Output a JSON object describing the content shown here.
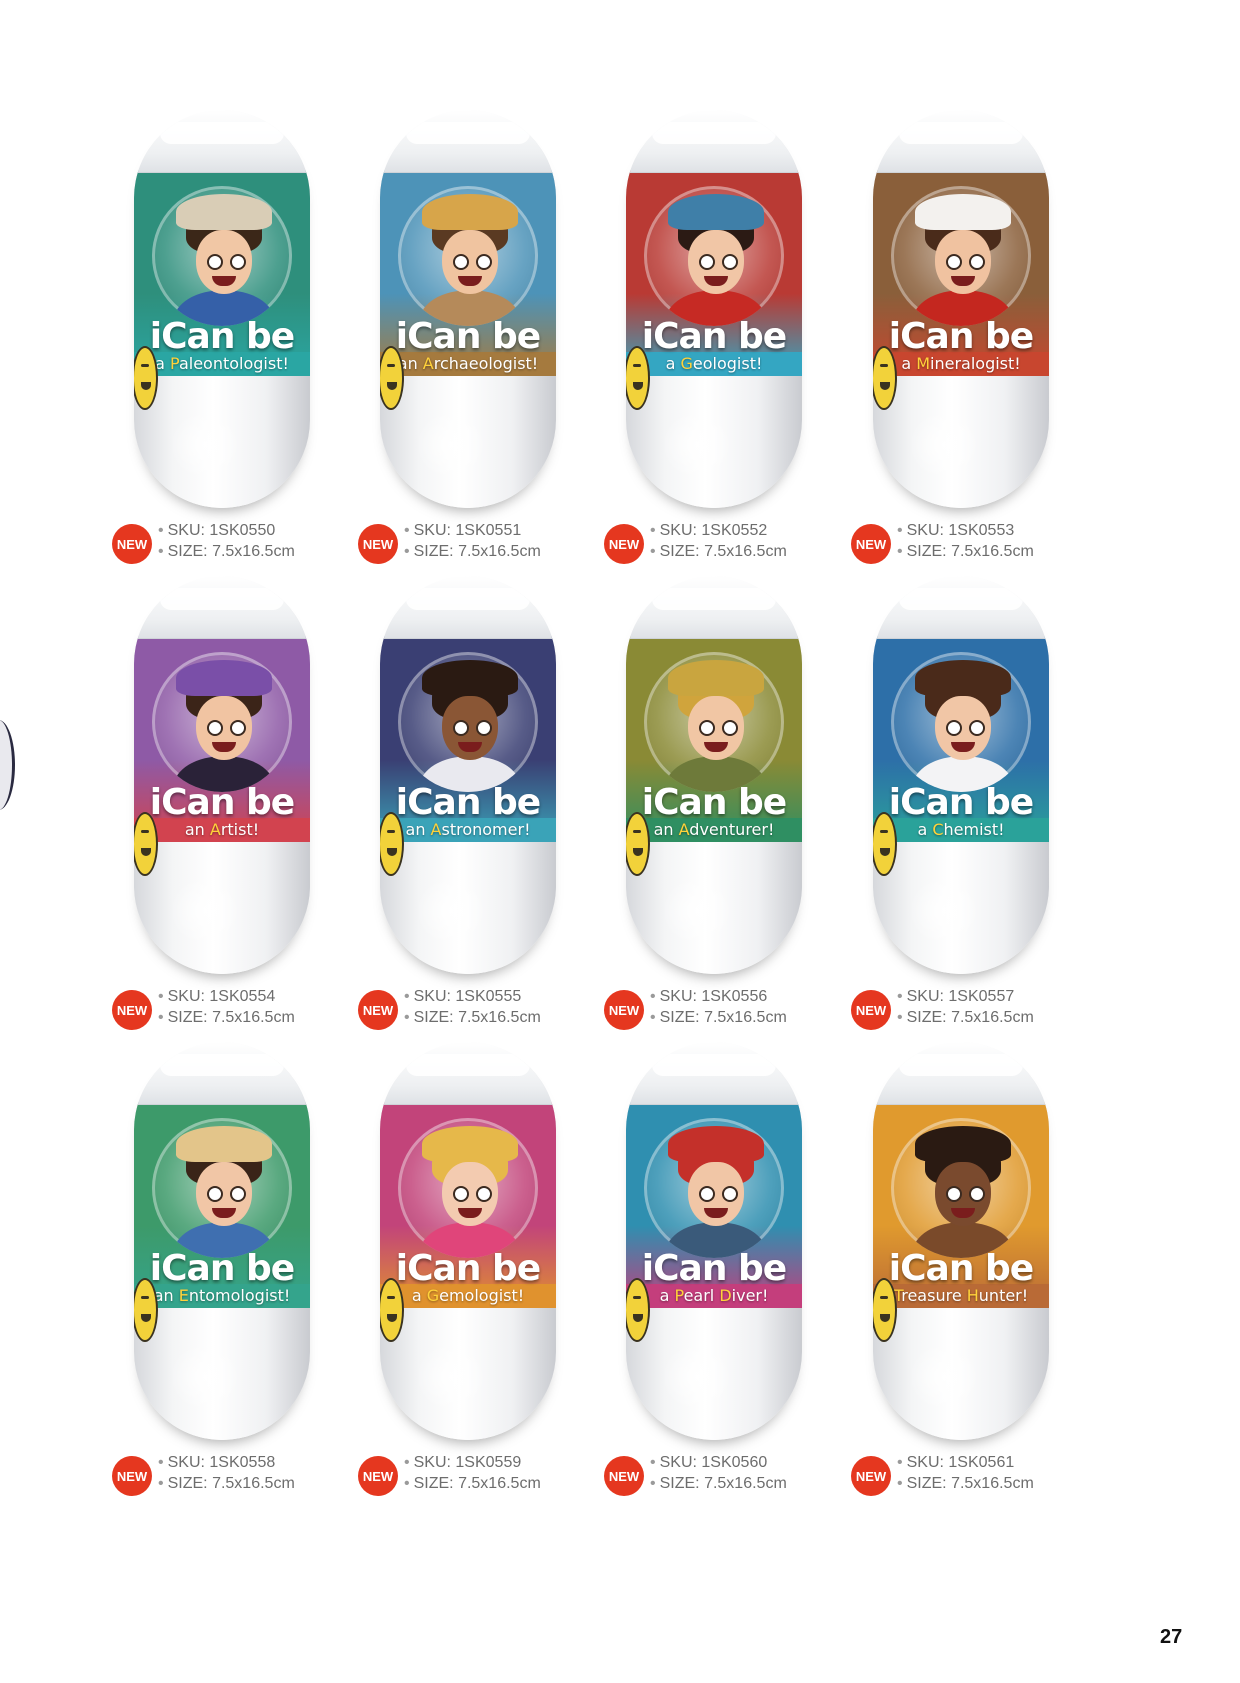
{
  "page_number": "27",
  "brand": "iCan be",
  "badge": "NEW",
  "products": [
    {
      "label_prefix": "a ",
      "label_initial": "P",
      "label_rest": "aleontologist!",
      "sku": "SKU: 1SK0550",
      "size": "SIZE: 7.5x16.5cm",
      "color_top": "#2e8f7c",
      "color_band": "#2aa6a3",
      "hair": "#3b2718",
      "hat": "#d9cdb6",
      "body": "#3560a8",
      "face": "#f1c7a5"
    },
    {
      "label_prefix": "an ",
      "label_initial": "A",
      "label_rest": "rchaeologist!",
      "sku": "SKU: 1SK0551",
      "size": "SIZE: 7.5x16.5cm",
      "color_top": "#4d93b8",
      "color_band": "#a57a3e",
      "hair": "#5a3a22",
      "hat": "#d7a54a",
      "body": "#b58a5a",
      "face": "#f0c4a0"
    },
    {
      "label_prefix": "a ",
      "label_initial": "G",
      "label_rest": "eologist!",
      "sku": "SKU: 1SK0552",
      "size": "SIZE: 7.5x16.5cm",
      "color_top": "#b93a34",
      "color_band": "#34a6c2",
      "hair": "#2b1a14",
      "hat": "#3f7fa8",
      "body": "#c62a24",
      "face": "#f1c6a6"
    },
    {
      "label_prefix": "a ",
      "label_initial": "M",
      "label_rest": "ineralogist!",
      "sku": "SKU: 1SK0553",
      "size": "SIZE: 7.5x16.5cm",
      "color_top": "#8a5f3a",
      "color_band": "#c8462f",
      "hair": "#4a2b1a",
      "hat": "#f3f1ee",
      "body": "#c4271f",
      "face": "#f0c2a0"
    },
    {
      "label_prefix": "an ",
      "label_initial": "A",
      "label_rest": "rtist!",
      "sku": "SKU: 1SK0554",
      "size": "SIZE: 7.5x16.5cm",
      "color_top": "#8e5aa6",
      "color_band": "#d2434f",
      "hair": "#3b2418",
      "hat": "#7a4fa8",
      "body": "#2a2238",
      "face": "#f1c4a2"
    },
    {
      "label_prefix": "an ",
      "label_initial": "A",
      "label_rest": "stronomer!",
      "sku": "SKU: 1SK0555",
      "size": "SIZE: 7.5x16.5cm",
      "color_top": "#3a3f73",
      "color_band": "#3aa3b8",
      "hair": "#2a1a12",
      "hat": "#2a1a12",
      "body": "#e9e9ef",
      "face": "#8a5635"
    },
    {
      "label_prefix": "an ",
      "label_initial": "A",
      "label_rest": "dventurer!",
      "sku": "SKU: 1SK0556",
      "size": "SIZE: 7.5x16.5cm",
      "color_top": "#8a8a35",
      "color_band": "#2f8f62",
      "hair": "#d0a43c",
      "hat": "#c9a53f",
      "body": "#6e7a3a",
      "face": "#f1c6a4"
    },
    {
      "label_prefix": "a ",
      "label_initial": "C",
      "label_rest": "hemist!",
      "sku": "SKU: 1SK0557",
      "size": "SIZE: 7.5x16.5cm",
      "color_top": "#2d6fa8",
      "color_band": "#2aa29a",
      "hair": "#4a2a1a",
      "hat": "#4a2a1a",
      "body": "#f3f3f5",
      "face": "#f1c6a6"
    },
    {
      "label_prefix": "an ",
      "label_initial": "E",
      "label_rest": "ntomologist!",
      "sku": "SKU: 1SK0558",
      "size": "SIZE: 7.5x16.5cm",
      "color_top": "#3d9a6a",
      "color_band": "#34a48c",
      "hair": "#3a2418",
      "hat": "#e3c58a",
      "body": "#3f6fb0",
      "face": "#f1c6a6"
    },
    {
      "label_prefix": "a ",
      "label_initial": "G",
      "label_rest": "emologist!",
      "sku": "SKU: 1SK0559",
      "size": "SIZE: 7.5x16.5cm",
      "color_top": "#c2447a",
      "color_band": "#e0922e",
      "hair": "#e6b84a",
      "hat": "#e6b84a",
      "body": "#e0457a",
      "face": "#f3cbb0"
    },
    {
      "label_prefix": "a ",
      "label_initial": "P",
      "label_rest": "earl ",
      "label_initial2": "D",
      "label_rest2": "iver!",
      "sku": "SKU: 1SK0560",
      "size": "SIZE: 7.5x16.5cm",
      "color_top": "#2f8fb0",
      "color_band": "#c43e7c",
      "hair": "#c4302a",
      "hat": "#c4302a",
      "body": "#3a5a7a",
      "face": "#f1c6a6"
    },
    {
      "label_prefix": "",
      "label_initial": "T",
      "label_rest": "reasure ",
      "label_initial2": "H",
      "label_rest2": "unter!",
      "sku": "SKU: 1SK0561",
      "size": "SIZE: 7.5x16.5cm",
      "color_top": "#e09a2e",
      "color_band": "#b96a36",
      "hair": "#2a1a12",
      "hat": "#2a1a12",
      "body": "#7a4a2a",
      "face": "#7a4a2e"
    }
  ]
}
